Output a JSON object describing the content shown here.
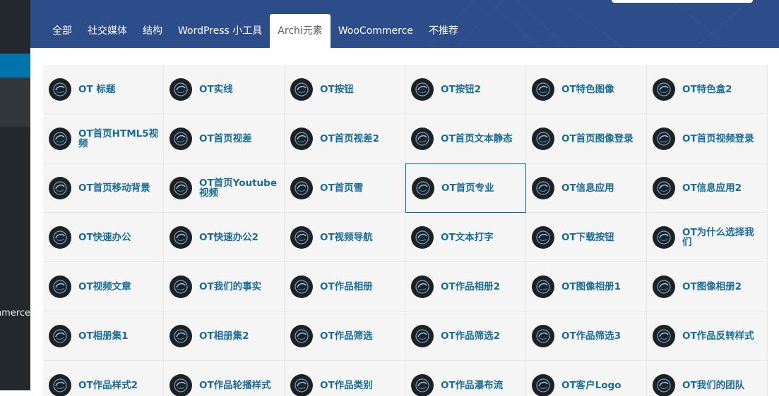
{
  "sidebar": {
    "partial_label": "mmerce"
  },
  "tabs": [
    {
      "label": "全部"
    },
    {
      "label": "社交媒体"
    },
    {
      "label": "结构"
    },
    {
      "label": "WordPress 小工具"
    },
    {
      "label": "Archi元素",
      "active": true
    },
    {
      "label": "WooCommerce"
    },
    {
      "label": "不推荐"
    }
  ],
  "elements": [
    "OT 标题",
    "OT实线",
    "OT按钮",
    "OT按钮2",
    "OT特色图像",
    "OT特色盒2",
    "OT首页HTML5视频",
    "OT首页视差",
    "OT首页视差2",
    "OT首页文本静态",
    "OT首页图像登录",
    "OT首页视频登录",
    "OT首页移动背景",
    "OT首页Youtube视频",
    "OT首页雪",
    "OT首页专业",
    "OT信息应用",
    "OT信息应用2",
    "OT快速办公",
    "OT快速办公2",
    "OT视频导航",
    "OT文本打字",
    "OT下载按钮",
    "OT为什么选择我们",
    "OT视频文章",
    "OT我们的事实",
    "OT作品相册",
    "OT作品相册2",
    "OT图像相册1",
    "OT图像相册2",
    "OT相册集1",
    "OT相册集2",
    "OT作品筛选",
    "OT作品筛选2",
    "OT作品筛选3",
    "OT作品反转样式",
    "OT作品样式2",
    "OT作品轮播样式",
    "OT作品类别",
    "OT作品瀑布流",
    "OT客户Logo",
    "OT我们的团队"
  ],
  "selected_element": "OT首页专业",
  "colors": {
    "header_bg": "#2c4c8a",
    "sidebar_bg": "#23282d",
    "sidebar_active": "#0073aa",
    "element_text": "#1a6c95",
    "selected_border": "#0a6fa0",
    "grid_bg": "#f5f5f5"
  },
  "icon": "logo-badge-icon"
}
